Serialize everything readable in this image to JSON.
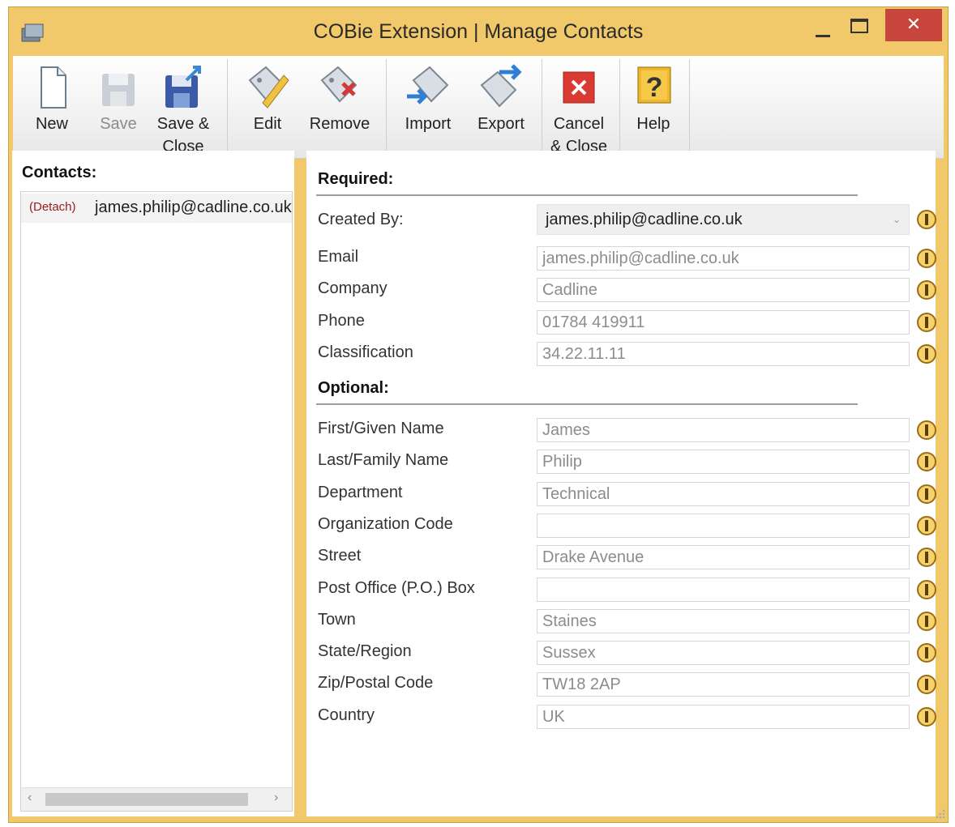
{
  "window": {
    "title": "COBie Extension | Manage Contacts",
    "close_glyph": "✕"
  },
  "toolbar": [
    {
      "id": "new",
      "label": "New",
      "icon": "new-document-icon",
      "enabled": true
    },
    {
      "id": "save",
      "label": "Save",
      "icon": "save-disk-icon",
      "enabled": false
    },
    {
      "id": "save_close",
      "label": "Save & Close",
      "icon": "save-close-icon",
      "enabled": true
    },
    {
      "id": "edit",
      "label": "Edit",
      "icon": "edit-tag-icon",
      "enabled": true
    },
    {
      "id": "remove",
      "label": "Remove",
      "icon": "remove-tag-icon",
      "enabled": true
    },
    {
      "id": "import",
      "label": "Import",
      "icon": "import-tag-icon",
      "enabled": true
    },
    {
      "id": "export",
      "label": "Export",
      "icon": "export-tag-icon",
      "enabled": true
    },
    {
      "id": "cancel_close",
      "label": "Cancel & Close",
      "icon": "cancel-close-icon",
      "enabled": true
    },
    {
      "id": "help",
      "label": "Help",
      "icon": "help-icon",
      "enabled": true
    }
  ],
  "contacts": {
    "header": "Contacts:",
    "items": [
      {
        "action": "(Detach)",
        "email": "james.philip@cadline.co.uk"
      }
    ],
    "scroll_left": "‹",
    "scroll_right": "›"
  },
  "required": {
    "header": "Required:",
    "created_by": {
      "label": "Created By:",
      "value": "james.philip@cadline.co.uk"
    },
    "fields": [
      {
        "label": "Email",
        "value": "james.philip@cadline.co.uk"
      },
      {
        "label": "Company",
        "value": "Cadline"
      },
      {
        "label": "Phone",
        "value": "01784 419911"
      },
      {
        "label": "Classification",
        "value": "34.22.11.11"
      }
    ]
  },
  "optional": {
    "header": "Optional:",
    "fields": [
      {
        "label": "First/Given Name",
        "value": "James"
      },
      {
        "label": "Last/Family Name",
        "value": "Philip"
      },
      {
        "label": "Department",
        "value": "Technical"
      },
      {
        "label": "Organization Code",
        "value": ""
      },
      {
        "label": "Street",
        "value": "Drake Avenue"
      },
      {
        "label": "Post Office (P.O.) Box",
        "value": ""
      },
      {
        "label": "Town",
        "value": "Staines"
      },
      {
        "label": "State/Region",
        "value": "Sussex"
      },
      {
        "label": "Zip/Postal Code",
        "value": "TW18 2AP"
      },
      {
        "label": "Country",
        "value": "UK"
      }
    ]
  },
  "colors": {
    "frame": "#f1c96a",
    "close": "#c7453a",
    "info_icon": "#c9952f",
    "detach": "#9c1b1b"
  }
}
